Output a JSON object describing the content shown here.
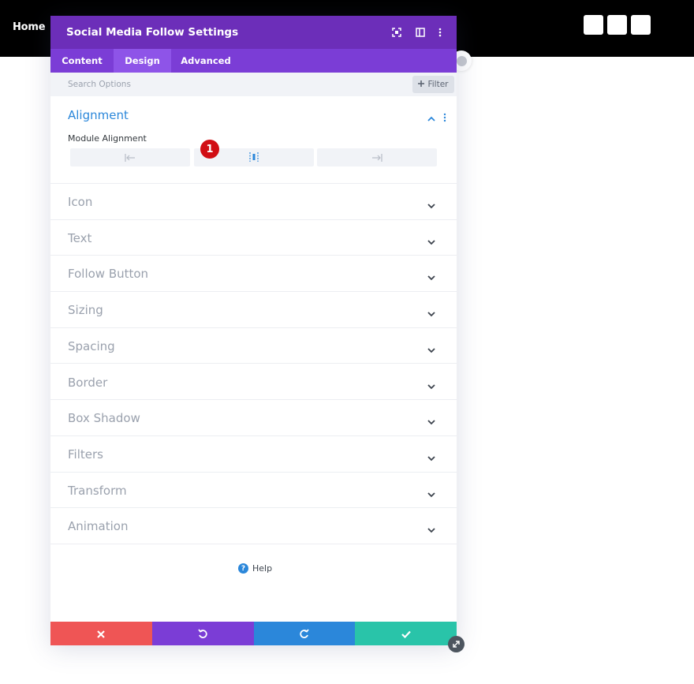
{
  "topbar": {
    "home_label": "Home",
    "square_count": 3
  },
  "modal": {
    "title": "Social Media Follow Settings",
    "header_icons": [
      "fullscreen-icon",
      "split-view-icon",
      "more-options-icon"
    ],
    "tabs": [
      {
        "label": "Content",
        "active": false
      },
      {
        "label": "Design",
        "active": true
      },
      {
        "label": "Advanced",
        "active": false
      }
    ],
    "search": {
      "placeholder": "Search Options"
    },
    "filter_label": "Filter",
    "alignment": {
      "title": "Alignment",
      "field_label": "Module Alignment",
      "options": [
        "align-left-icon",
        "align-center-icon",
        "align-right-icon"
      ],
      "badge": "1"
    },
    "sections": [
      {
        "label": "Icon"
      },
      {
        "label": "Text"
      },
      {
        "label": "Follow Button"
      },
      {
        "label": "Sizing"
      },
      {
        "label": "Spacing"
      },
      {
        "label": "Border"
      },
      {
        "label": "Box Shadow"
      },
      {
        "label": "Filters"
      },
      {
        "label": "Transform"
      },
      {
        "label": "Animation"
      }
    ],
    "help_label": "Help",
    "footer": [
      {
        "icon": "close-icon",
        "color": "#ef5555"
      },
      {
        "icon": "undo-icon",
        "color": "#7b3dd6"
      },
      {
        "icon": "redo-icon",
        "color": "#2b87da"
      },
      {
        "icon": "check-icon",
        "color": "#29c4a9"
      }
    ]
  },
  "colors": {
    "header": "#6c2eb9",
    "tabs": "#7b3dd6",
    "active_tab": "#8e54e8",
    "accent": "#2b87da",
    "badge": "#d10e14"
  }
}
